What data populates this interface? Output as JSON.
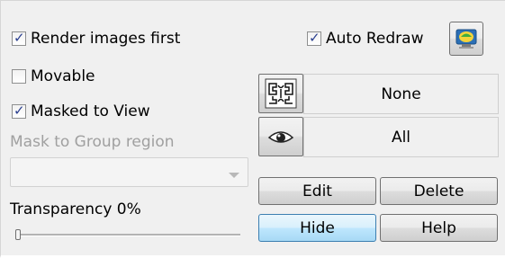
{
  "options": {
    "render_images_first": {
      "label": "Render images first",
      "checked": true
    },
    "auto_redraw": {
      "label": "Auto Redraw",
      "checked": true
    },
    "movable": {
      "label": "Movable",
      "checked": false
    },
    "masked_to_view": {
      "label": "Masked to View",
      "checked": true
    }
  },
  "mask_group": {
    "label": "Mask to Group region",
    "selected": ""
  },
  "fields": {
    "pattern_value": "None",
    "visibility_value": "All"
  },
  "transparency": {
    "label": "Transparency 0%",
    "percent": 0
  },
  "buttons": {
    "edit": "Edit",
    "delete": "Delete",
    "hide": "Hide",
    "help": "Help"
  },
  "icons": {
    "redraw": "redraw-icon",
    "pattern": "pattern-icon",
    "eye": "eye-icon"
  }
}
